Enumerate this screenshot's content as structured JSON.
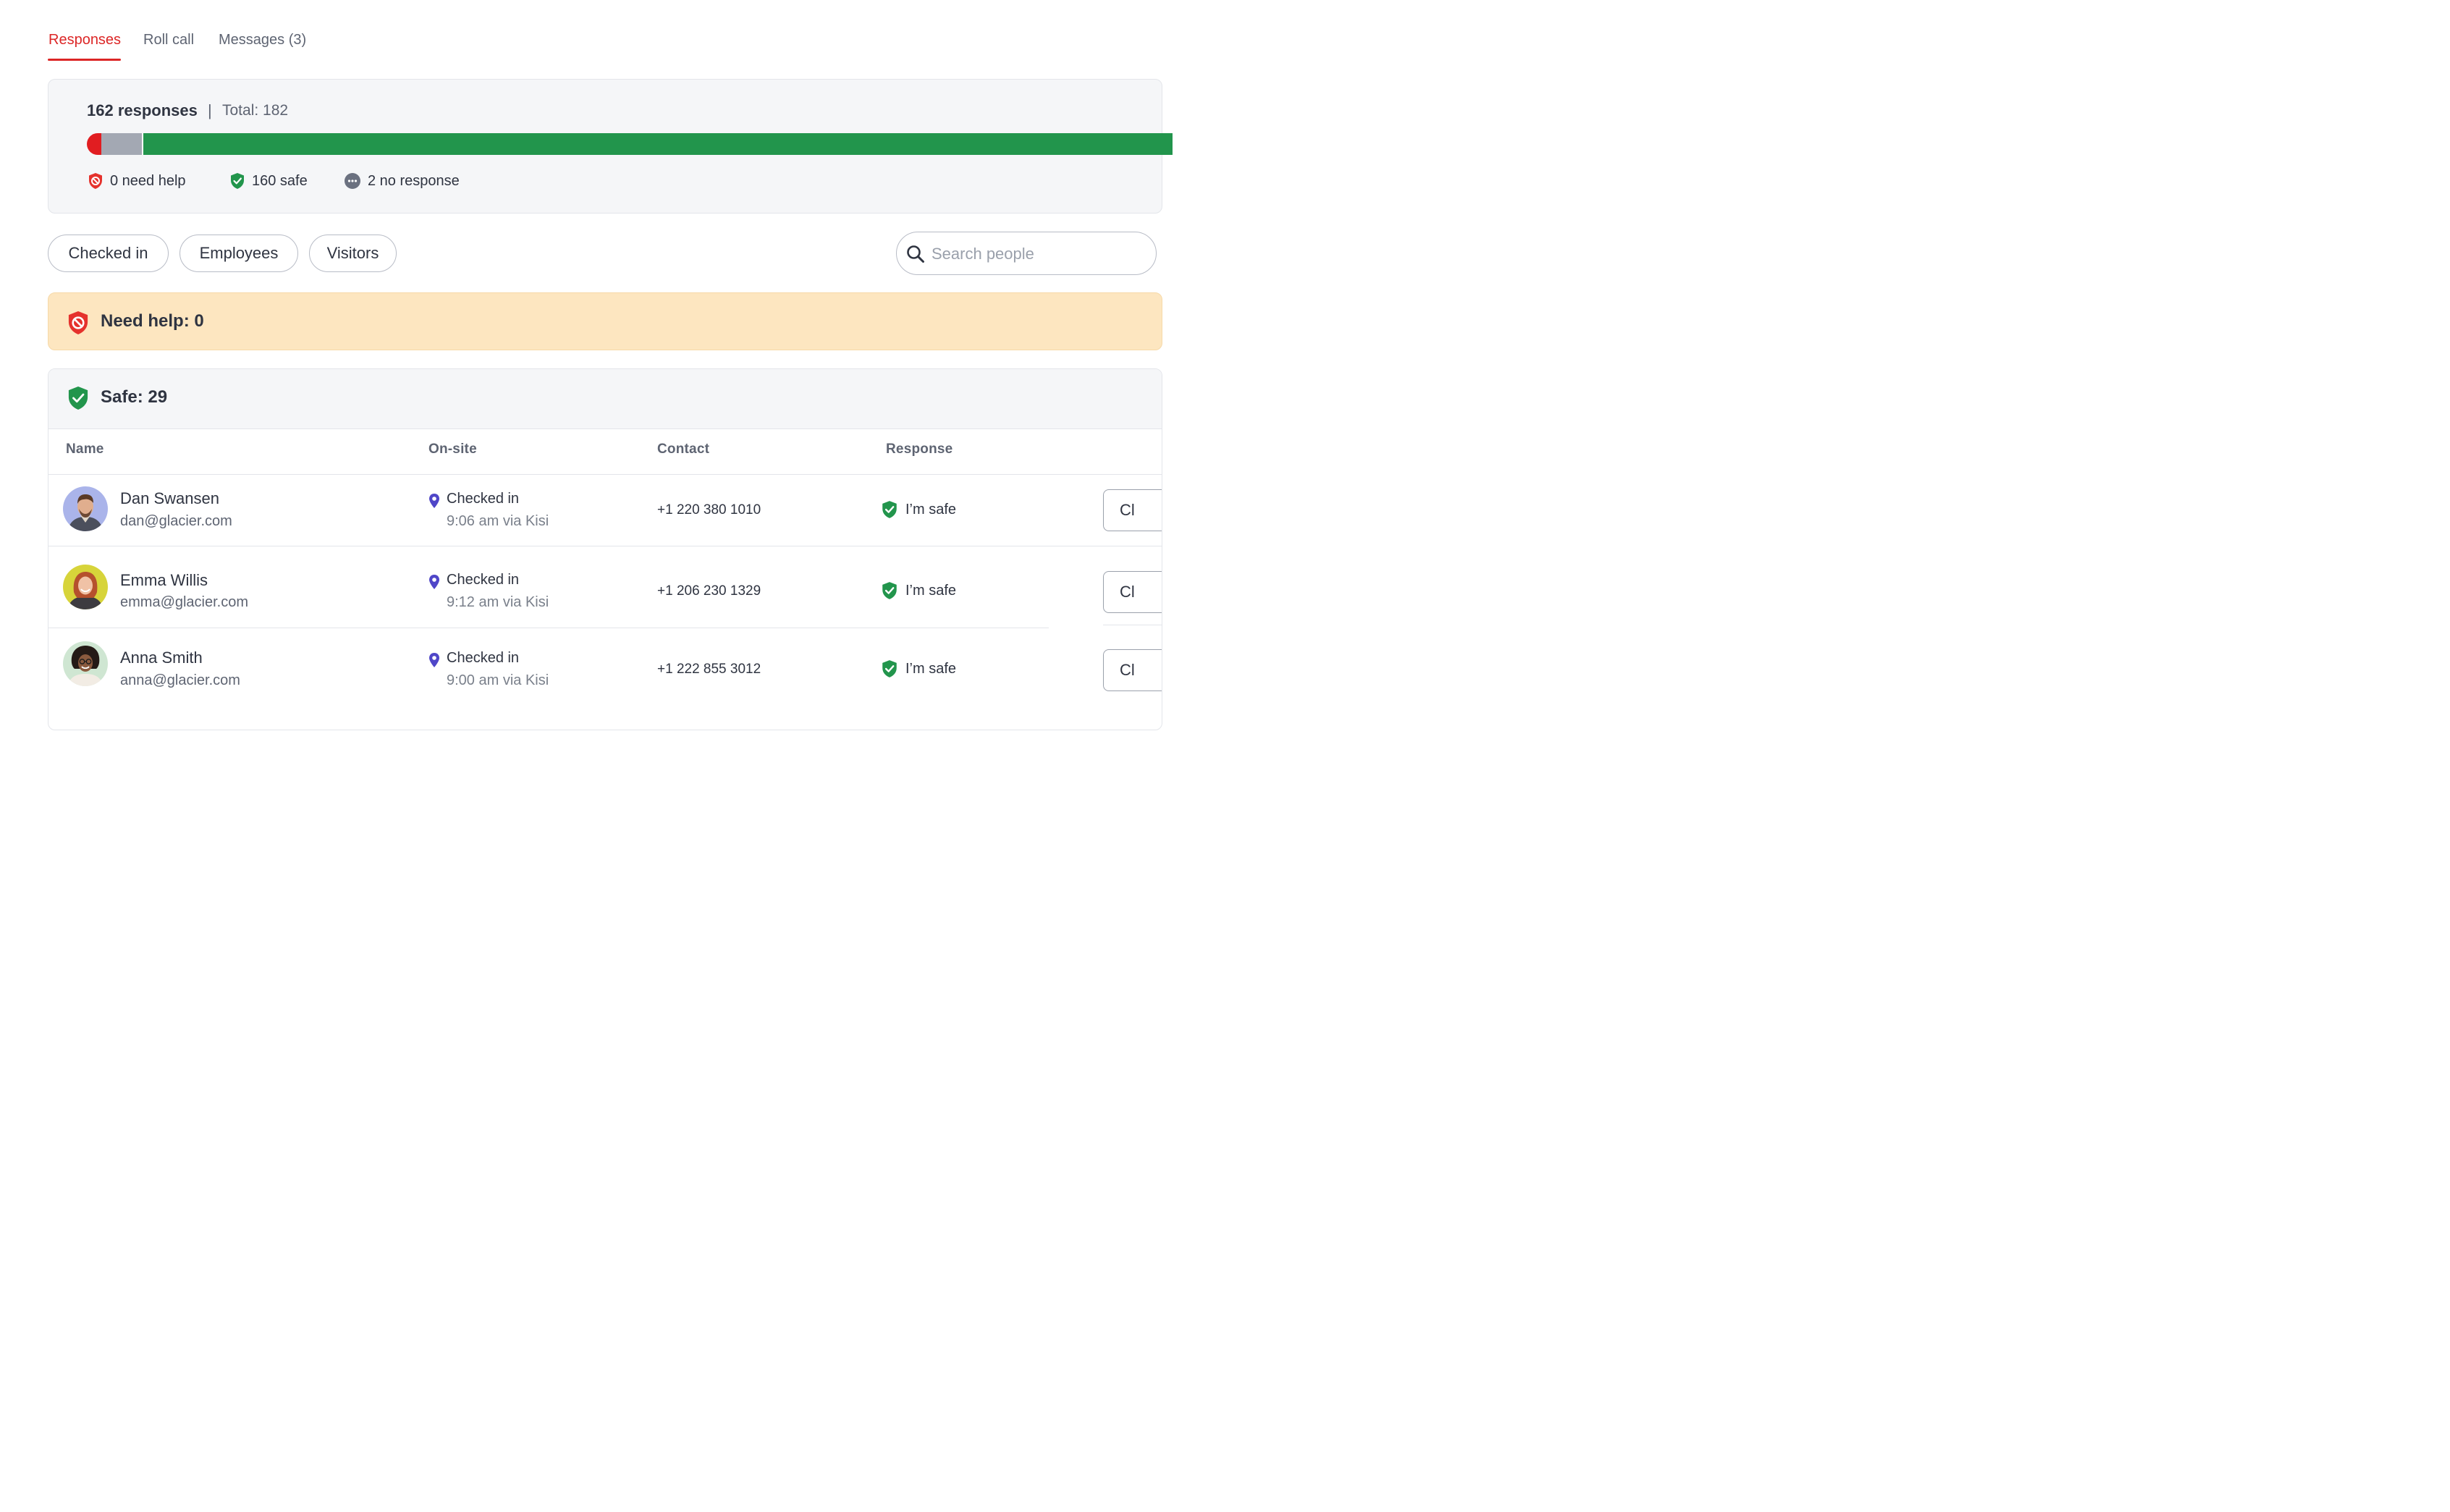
{
  "tabs": [
    {
      "label": "Responses",
      "active": true
    },
    {
      "label": "Roll call",
      "active": false
    },
    {
      "label": "Messages (3)",
      "active": false
    }
  ],
  "summary": {
    "responses": "162 responses",
    "separator": "|",
    "total": "Total: 182",
    "bar": {
      "need_help": 0,
      "no_response": 2,
      "safe": 160,
      "total": 162
    },
    "legend": {
      "need_help": "0 need help",
      "safe": "160 safe",
      "no_response": "2 no response"
    }
  },
  "filters": [
    "Checked in",
    "Employees",
    "Visitors"
  ],
  "search": {
    "placeholder": "Search people",
    "value": ""
  },
  "need_help_section": {
    "title": "Need help: 0"
  },
  "safe_section": {
    "title": "Safe: 29",
    "columns": [
      "Name",
      "On-site",
      "Contact",
      "Response"
    ],
    "rows": [
      {
        "name": "Dan Swansen",
        "email": "dan@glacier.com",
        "onsite": "Checked in",
        "onsite_detail": "9:06 am via Kisi",
        "contact": "+1 220 380 1010",
        "response": "I’m safe",
        "action": "Cl"
      },
      {
        "name": "Emma Willis",
        "email": "emma@glacier.com",
        "onsite": "Checked in",
        "onsite_detail": "9:12 am via Kisi",
        "contact": "+1 206 230 1329",
        "response": "I’m safe",
        "action": "Cl"
      },
      {
        "name": "Anna Smith",
        "email": "anna@glacier.com",
        "onsite": "Checked in",
        "onsite_detail": "9:00 am via Kisi",
        "contact": "+1 222 855 3012",
        "response": "I’m safe",
        "action": "Cl"
      }
    ]
  },
  "colors": {
    "accent_red": "#dc2626",
    "safe_green": "#22954c",
    "no_response_gray": "#a3a8b3",
    "warning_bg": "#fde6c0",
    "pin_purple": "#4f46c8"
  },
  "icons": {
    "need_help": "shield-block-icon",
    "safe": "shield-check-icon",
    "no_response": "dots-circle-icon",
    "search": "search-icon",
    "location": "location-pin-icon"
  }
}
